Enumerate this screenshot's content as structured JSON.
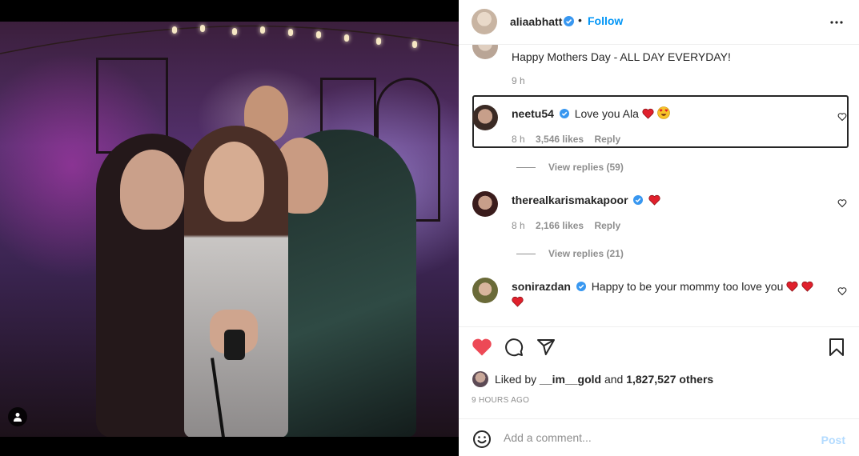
{
  "post": {
    "author": "aliaabhatt",
    "follow_label": "Follow",
    "separator": "•"
  },
  "comments": [
    {
      "text": "Happy Mothers Day - ALL DAY EVERYDAY!",
      "time": "9 h"
    },
    {
      "username": "neetu54",
      "text": "Love you Ala",
      "time": "8 h",
      "likes": "3,546 likes",
      "reply_label": "Reply",
      "view_replies": "View replies (59)"
    },
    {
      "username": "therealkarismakapoor",
      "text": "",
      "time": "8 h",
      "likes": "2,166 likes",
      "reply_label": "Reply",
      "view_replies": "View replies (21)"
    },
    {
      "username": "sonirazdan",
      "text": "Happy to be your mommy too love you"
    }
  ],
  "likes": {
    "prefix": "Liked by",
    "user": "__im__gold",
    "connector": "and",
    "others": "1,827,527 others"
  },
  "timestamp": "9 HOURS AGO",
  "add_comment": {
    "placeholder": "Add a comment...",
    "post_label": "Post"
  },
  "colors": {
    "accent": "#0095f6",
    "like_red": "#ed4956",
    "verified": "#3897f0",
    "muted": "#8e8e8e",
    "post_disabled": "#b3dbff"
  },
  "icons": [
    "person-tag-icon",
    "verified-badge-icon",
    "more-options-icon",
    "heart-outline-icon",
    "heart-filled-icon",
    "comment-icon",
    "share-icon",
    "bookmark-icon",
    "emoji-icon",
    "red-heart-emoji",
    "heart-eyes-emoji"
  ]
}
